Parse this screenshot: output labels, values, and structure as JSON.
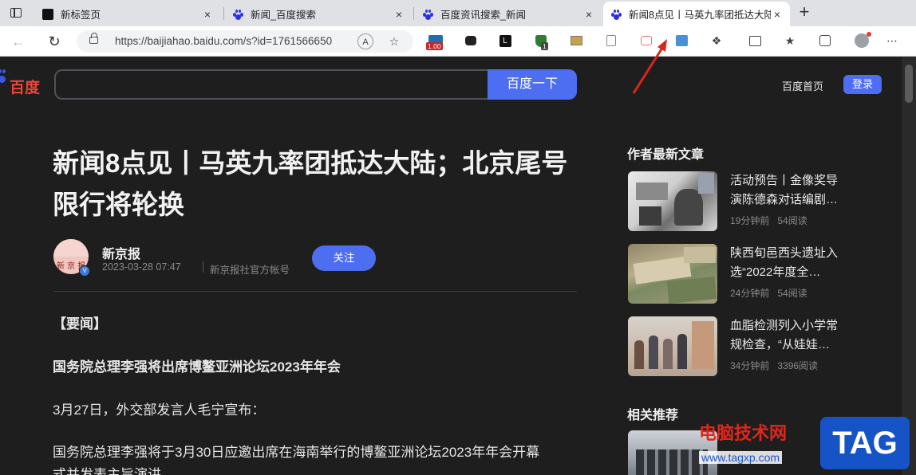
{
  "tabs": [
    {
      "title": "新标签页",
      "icon": "new-tab-page-icon"
    },
    {
      "title": "新闻_百度搜索",
      "icon": "baidu-paw-icon"
    },
    {
      "title": "百度资讯搜索_新闻",
      "icon": "baidu-paw-icon"
    },
    {
      "title": "新闻8点见丨马英九率团抵达大陆",
      "icon": "baidu-paw-icon",
      "active": true
    }
  ],
  "tab_close": "×",
  "new_tab": "+",
  "address_bar": {
    "url": "https://baijiahao.baidu.com/s?id=1761566650",
    "read_aloud_icon": "A",
    "extension_badges": {
      "counter": "1.00",
      "shield": "1"
    }
  },
  "page": {
    "logo_text": "百度",
    "search_button": "百度一下",
    "home_link": "百度首页",
    "login_button": "登录",
    "article": {
      "title": "新闻8点见丨马英九率团抵达大陆；北京尾号限行将轮换",
      "author_name": "新京报",
      "author_avatar_text": "新 京 报",
      "date": "2023-03-28 07:47",
      "author_desc": "新京报社官方帐号",
      "follow_button": "关注",
      "paragraphs": [
        "【要闻】",
        "国务院总理李强将出席博鳌亚洲论坛2023年年会",
        "3月27日，外交部发言人毛宁宣布：",
        "国务院总理李强将于3月30日应邀出席在海南举行的博鳌亚洲论坛2023年年会开幕",
        "式并发表主旨演讲。"
      ]
    },
    "sidebar": {
      "latest_heading": "作者最新文章",
      "items": [
        {
          "title_line1": "活动预告丨金像奖导",
          "title_line2": "演陈德森对话编剧…",
          "time": "19分钟前",
          "reads": "54阅读"
        },
        {
          "title_line1": "陕西旬邑西头遗址入",
          "title_line2": "选“2022年度全…",
          "time": "24分钟前",
          "reads": "54阅读"
        },
        {
          "title_line1": "血脂检测列入小学常",
          "title_line2": "规检查，“从娃娃…",
          "time": "34分钟前",
          "reads": "3396阅读"
        }
      ],
      "related_heading": "相关推荐"
    }
  },
  "watermark": {
    "text": "电脑技术网",
    "url": "www.tagxp.com",
    "tag": "TAG"
  },
  "colors": {
    "accent": "#4e6ef2",
    "page_bg": "#1e1e1e",
    "arrow": "#d9261c"
  }
}
